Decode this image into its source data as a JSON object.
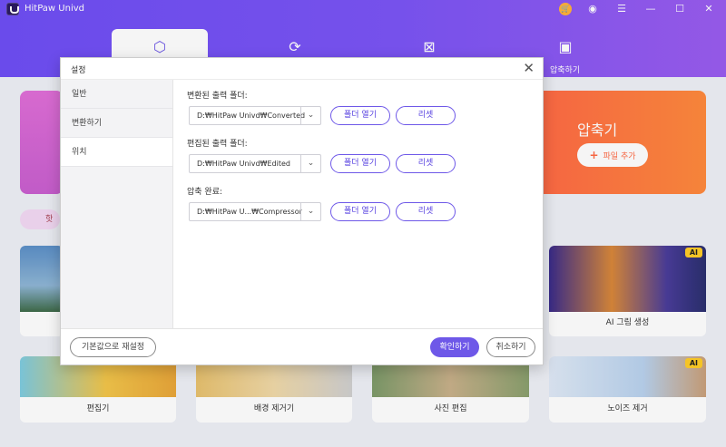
{
  "app": {
    "title": "HitPaw Univd"
  },
  "colors": {
    "accent": "#6e58e8",
    "header": "#7452f5",
    "compress_banner": "#ff7a40",
    "ai_badge": "#ffcc27"
  },
  "window_controls": {
    "cart": "shopping-cart-icon",
    "account": "user-icon",
    "menu": "hamburger-icon",
    "minimize": "minimize-icon",
    "maximize": "maximize-icon",
    "close": "close-icon"
  },
  "tabs": [
    {
      "icon": "home-icon",
      "label": ""
    },
    {
      "icon": "convert-icon",
      "label": ""
    },
    {
      "icon": "edit-icon",
      "label": ""
    },
    {
      "icon": "compress-icon",
      "label": "압축하기"
    }
  ],
  "background": {
    "compress_banner": {
      "title": "압축기",
      "button": "파일 추가"
    },
    "chip": "핫",
    "cards": [
      {
        "label": "",
        "ai": false
      },
      {
        "label": "AI 그림 생성",
        "ai": true
      },
      {
        "label": "편집기",
        "ai": false
      },
      {
        "label": "배경 제거기",
        "ai": false
      },
      {
        "label": "사진 편집",
        "ai": false
      },
      {
        "label": "노이즈 제거",
        "ai": true
      }
    ],
    "ai_badge": "AI"
  },
  "dialog": {
    "title": "설정",
    "sidebar": [
      "일반",
      "변환하기",
      "위치"
    ],
    "active_sidebar": "위치",
    "rows": [
      {
        "label": "변환된 출력 폴더:",
        "path": "D:₩HitPaw Univd₩Converted",
        "open": "폴더 열기",
        "reset": "리셋"
      },
      {
        "label": "편집된 출력 폴더:",
        "path": "D:₩HitPaw Univd₩Edited",
        "open": "폴더 열기",
        "reset": "리셋"
      },
      {
        "label": "압축 완료:",
        "path": "D:₩HitPaw U...₩Compressor",
        "open": "폴더 열기",
        "reset": "리셋"
      }
    ],
    "footer": {
      "reset_defaults": "기본값으로 재설정",
      "confirm": "확인하기",
      "cancel": "취소하기"
    }
  }
}
